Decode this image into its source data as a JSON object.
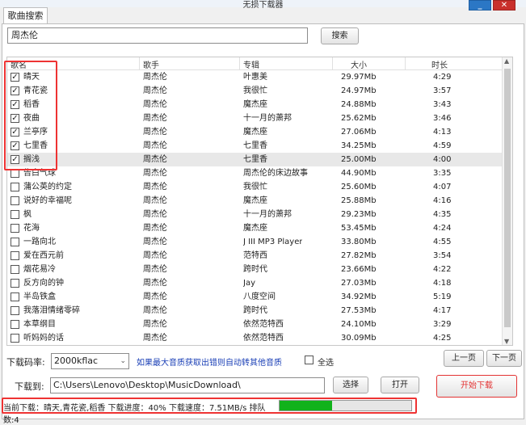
{
  "window": {
    "title": "无损下载器",
    "minimize_glyph": "_",
    "close_glyph": "✕"
  },
  "tab": {
    "label": "歌曲搜索"
  },
  "search": {
    "value": "周杰伦",
    "button_label": "搜索"
  },
  "table": {
    "columns": [
      "歌名",
      "歌手",
      "专辑",
      "大小",
      "时长"
    ],
    "rows": [
      {
        "checked": true,
        "name": "晴天",
        "artist": "周杰伦",
        "album": "叶惠美",
        "size": "29.97Mb",
        "duration": "4:29"
      },
      {
        "checked": true,
        "name": "青花瓷",
        "artist": "周杰伦",
        "album": "我很忙",
        "size": "24.97Mb",
        "duration": "3:57"
      },
      {
        "checked": true,
        "name": "稻香",
        "artist": "周杰伦",
        "album": "魔杰座",
        "size": "24.88Mb",
        "duration": "3:43"
      },
      {
        "checked": true,
        "name": "夜曲",
        "artist": "周杰伦",
        "album": "十一月的萧邦",
        "size": "25.62Mb",
        "duration": "3:46"
      },
      {
        "checked": true,
        "name": "兰亭序",
        "artist": "周杰伦",
        "album": "魔杰座",
        "size": "27.06Mb",
        "duration": "4:13"
      },
      {
        "checked": true,
        "name": "七里香",
        "artist": "周杰伦",
        "album": "七里香",
        "size": "34.25Mb",
        "duration": "4:59"
      },
      {
        "checked": true,
        "name": "搁浅",
        "artist": "周杰伦",
        "album": "七里香",
        "size": "25.00Mb",
        "duration": "4:00"
      },
      {
        "checked": false,
        "name": "告白气球",
        "artist": "周杰伦",
        "album": "周杰伦的床边故事",
        "size": "44.90Mb",
        "duration": "3:35"
      },
      {
        "checked": false,
        "name": "蒲公英的约定",
        "artist": "周杰伦",
        "album": "我很忙",
        "size": "25.60Mb",
        "duration": "4:07"
      },
      {
        "checked": false,
        "name": "说好的幸福呢",
        "artist": "周杰伦",
        "album": "魔杰座",
        "size": "25.88Mb",
        "duration": "4:16"
      },
      {
        "checked": false,
        "name": "枫",
        "artist": "周杰伦",
        "album": "十一月的萧邦",
        "size": "29.23Mb",
        "duration": "4:35"
      },
      {
        "checked": false,
        "name": "花海",
        "artist": "周杰伦",
        "album": "魔杰座",
        "size": "53.45Mb",
        "duration": "4:24"
      },
      {
        "checked": false,
        "name": "一路向北",
        "artist": "周杰伦",
        "album": "J III MP3 Player",
        "size": "33.80Mb",
        "duration": "4:55"
      },
      {
        "checked": false,
        "name": "爱在西元前",
        "artist": "周杰伦",
        "album": "范特西",
        "size": "27.82Mb",
        "duration": "3:54"
      },
      {
        "checked": false,
        "name": "烟花易冷",
        "artist": "周杰伦",
        "album": "跨时代",
        "size": "23.66Mb",
        "duration": "4:22"
      },
      {
        "checked": false,
        "name": "反方向的钟",
        "artist": "周杰伦",
        "album": "Jay",
        "size": "27.03Mb",
        "duration": "4:18"
      },
      {
        "checked": false,
        "name": "半岛铁盒",
        "artist": "周杰伦",
        "album": "八度空间",
        "size": "34.92Mb",
        "duration": "5:19"
      },
      {
        "checked": false,
        "name": "我落泪情绪零碎",
        "artist": "周杰伦",
        "album": "跨时代",
        "size": "27.53Mb",
        "duration": "4:17"
      },
      {
        "checked": false,
        "name": "本草纲目",
        "artist": "周杰伦",
        "album": "依然范特西",
        "size": "24.10Mb",
        "duration": "3:29"
      },
      {
        "checked": false,
        "name": "听妈妈的话",
        "artist": "周杰伦",
        "album": "依然范特西",
        "size": "30.09Mb",
        "duration": "4:25"
      }
    ]
  },
  "controls": {
    "bitrate_label": "下载码率:",
    "bitrate_value": "2000kflac",
    "notice": "如果最大音质获取出错则自动转其他音质",
    "select_all_label": "全选",
    "prev_page": "上一页",
    "next_page": "下一页",
    "download_to_label": "下载到:",
    "download_path": "C:\\Users\\Lenovo\\Desktop\\MusicDownload\\",
    "choose_button": "选择",
    "open_button": "打开",
    "start_button": "开始下载"
  },
  "status": {
    "text": "当前下载：晴天,青花瓷,稻香 下载进度：40% 下载速度：7.51MB/s 排队数:4",
    "progress_fraction": 0.4
  },
  "colors": {
    "highlight_box": "#e33333",
    "progress": "#11b21b",
    "link": "#1a3fb6",
    "start_button_text": "#e33333"
  }
}
